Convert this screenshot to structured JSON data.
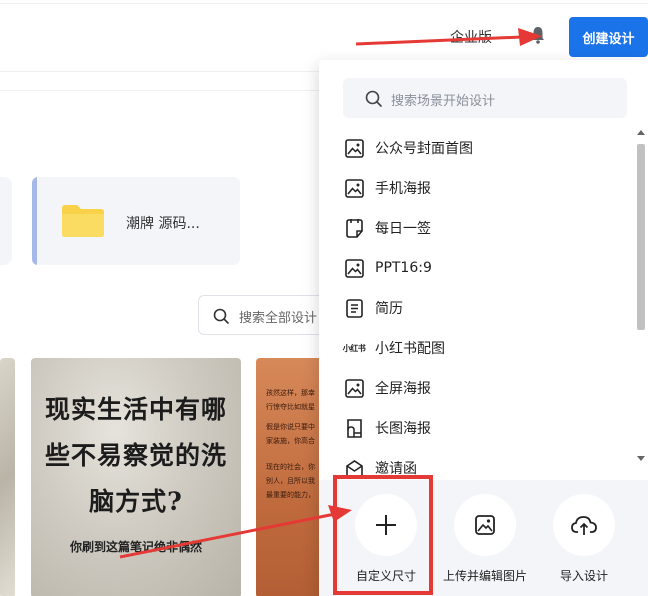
{
  "header": {
    "enterprise_label": "企业版",
    "create_button_label": "创建设计"
  },
  "folder": {
    "name": "潮牌 源码..."
  },
  "search_all": {
    "placeholder": "搜索全部设计"
  },
  "thumbnails": {
    "poster_lines": [
      "现实生活中有哪",
      "些不易察觉的洗",
      "脑方式?"
    ],
    "poster_subtitle": "你刷到这篇笔记绝非偶然",
    "side_text": [
      "孩然这样，那幸",
      "行惊夺比如就星",
      "假是你说只要中",
      "家装施，你高合",
      "现在的社会，你",
      "别人，且所以我",
      "最重要的能力，"
    ]
  },
  "dropdown": {
    "search_placeholder": "搜索场景开始设计",
    "items": [
      {
        "label": "公众号封面首图",
        "icon": "image-icon"
      },
      {
        "label": "手机海报",
        "icon": "image-icon"
      },
      {
        "label": "每日一签",
        "icon": "note-icon"
      },
      {
        "label": "PPT16:9",
        "icon": "image-icon"
      },
      {
        "label": "简历",
        "icon": "document-icon"
      },
      {
        "label": "小红书配图",
        "icon": "xiaohongshu-icon",
        "icon_text": "小红书"
      },
      {
        "label": "全屏海报",
        "icon": "image-icon"
      },
      {
        "label": "长图海报",
        "icon": "long-image-icon"
      },
      {
        "label": "邀请函",
        "icon": "envelope-icon"
      }
    ],
    "actions": [
      {
        "label": "自定义尺寸",
        "icon": "plus-icon"
      },
      {
        "label": "上传并编辑图片",
        "icon": "image-upload-icon"
      },
      {
        "label": "导入设计",
        "icon": "cloud-upload-icon"
      }
    ]
  },
  "colors": {
    "primary": "#1a73e8",
    "annotation_red": "#e53935",
    "panel_gray": "#f3f5f9",
    "folder_yellow": "#f9d24a"
  }
}
